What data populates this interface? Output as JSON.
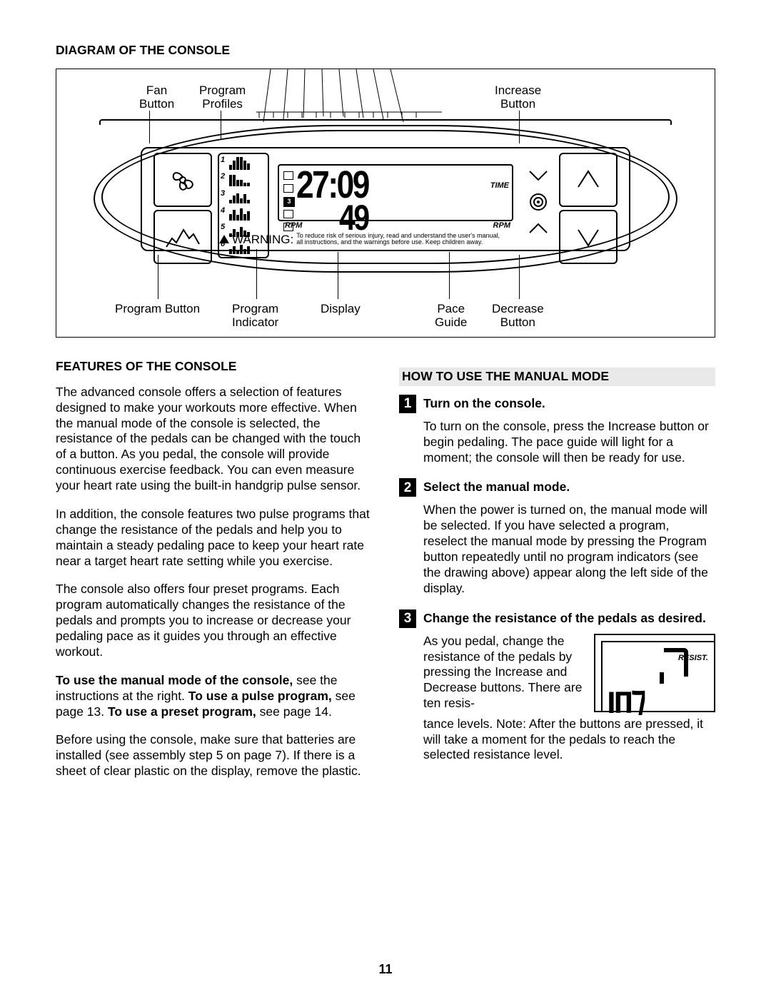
{
  "title_diagram": "DIAGRAM OF THE CONSOLE",
  "callouts": {
    "fan": "Fan\nButton",
    "profiles": "Program\nProfiles",
    "increase": "Increase\nButton",
    "prog_btn": "Program Button",
    "prog_ind": "Program\nIndicator",
    "display": "Display",
    "pace": "Pace\nGuide",
    "decrease": "Decrease\nButton"
  },
  "lcd": {
    "indicator_active": "3",
    "time_value": "27:09",
    "rpm_value": "49",
    "time_label": "TIME",
    "rpm_label": "RPM"
  },
  "profile_nums": [
    "1",
    "2",
    "3",
    "4",
    "5",
    "6"
  ],
  "warning_word": "WARNING:",
  "warning_line1": "To reduce risk of serious injury, read and understand the user's manual,",
  "warning_line2": "all instructions, and the warnings before use. Keep children away.",
  "features_title": "FEATURES OF THE CONSOLE",
  "features_p1": "The advanced console offers a selection of features designed to make your workouts more effective. When the manual mode of the console is selected, the resistance of the pedals can be changed with the touch of a button. As you pedal, the console will provide continuous exercise feedback. You can even measure your heart rate using the built-in handgrip pulse sensor.",
  "features_p2": "In addition, the console features two pulse programs that change the resistance of the pedals and help you to maintain a steady pedaling pace to keep your heart rate near a target heart rate setting while you exercise.",
  "features_p3": "The console also offers four preset programs. Each program automatically changes the resistance of the pedals and prompts you to increase or decrease your pedaling pace as it guides you through an effective workout.",
  "features_p4a": "To use the manual mode of the console,",
  "features_p4b": " see the instructions at the right. ",
  "features_p4c": "To use a pulse program,",
  "features_p4d": " see page 13. ",
  "features_p4e": "To use a preset program,",
  "features_p4f": " see page 14.",
  "features_p5": "Before using the console, make sure that batteries are installed (see assembly step 5 on page 7). If there is a sheet of clear plastic on the display, remove the plastic.",
  "howto_title": "HOW TO USE THE MANUAL MODE",
  "step1_num": "1",
  "step1_title": "Turn on the console.",
  "step1_body": "To turn on the console, press the Increase button or begin pedaling. The pace guide will light for a moment; the console will then be ready for use.",
  "step2_num": "2",
  "step2_title": "Select the manual mode.",
  "step2_body": "When the power is turned on, the manual mode will be selected. If you have selected a program, reselect the manual mode by pressing the Program button repeatedly until no program indicators (see the drawing above) appear along the left side of the display.",
  "step3_num": "3",
  "step3_title": "Change the resistance of the pedals as desired.",
  "step3_body_a": "As you pedal, change the resistance of the pedals by pressing the Increase and Decrease buttons. There are ten resis-",
  "step3_body_b": "tance levels. Note: After the buttons are pressed, it will take a moment for the pedals to reach the selected resistance level.",
  "mini_resist": "RESIST.",
  "mini_value": "ıп⁊",
  "page_number": "11"
}
